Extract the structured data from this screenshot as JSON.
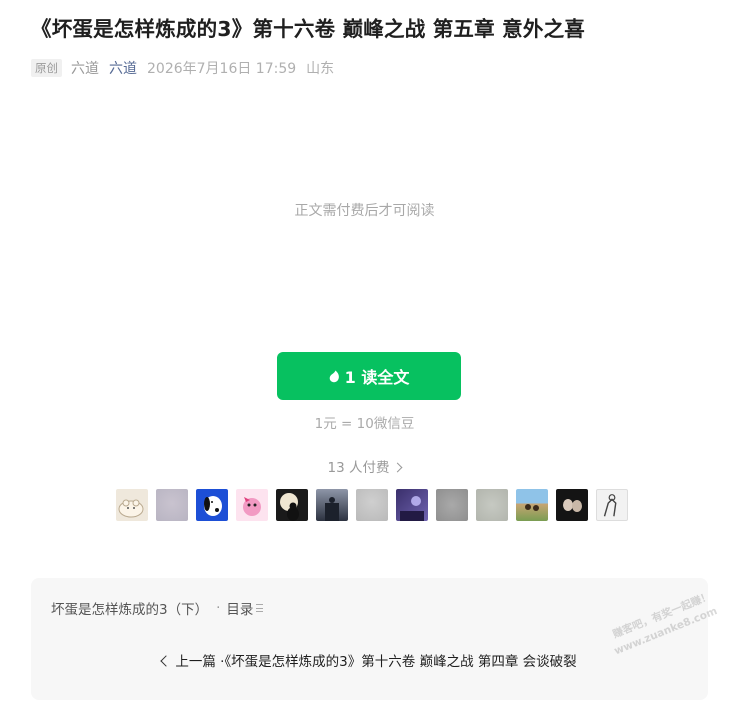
{
  "article": {
    "title": "《坏蛋是怎样炼成的3》第十六卷 巅峰之战 第五章 意外之喜",
    "tag": "原创",
    "author": "六道",
    "account": "六道",
    "datetime": "2026年7月16日 17:59",
    "location": "山东"
  },
  "paywall": {
    "notice": "正文需付费后才可阅读",
    "button_label": "1 读全文",
    "button_icon": "wechat-bean-icon",
    "exchange_rate": "1元 = 10微信豆",
    "payers_text": "13 人付费",
    "payers_count": 13,
    "accent_color": "#07c160"
  },
  "payer_avatars": [
    {
      "name": "avatar-cartoon-bear"
    },
    {
      "name": "avatar-blurred-1"
    },
    {
      "name": "avatar-snoopy"
    },
    {
      "name": "avatar-pink-cartoon"
    },
    {
      "name": "avatar-moon-silhouette"
    },
    {
      "name": "avatar-night-photo"
    },
    {
      "name": "avatar-blurred-2"
    },
    {
      "name": "avatar-purple-night"
    },
    {
      "name": "avatar-blurred-3"
    },
    {
      "name": "avatar-blurred-4"
    },
    {
      "name": "avatar-beach-photo"
    },
    {
      "name": "avatar-dark-couple"
    },
    {
      "name": "avatar-sketch"
    }
  ],
  "album": {
    "name": "坏蛋是怎样炼成的3（下）",
    "separator": "·",
    "toc_label": "目录",
    "prev_label": "上一篇 ·",
    "prev_title": "《坏蛋是怎样炼成的3》第十六卷 巅峰之战 第四章 会谈破裂"
  },
  "watermark": {
    "line1": "赚客吧，有奖一起赚！",
    "line2": "www.zuanke8.com"
  }
}
